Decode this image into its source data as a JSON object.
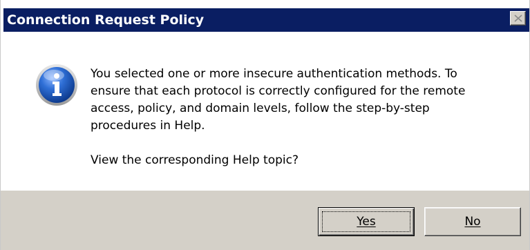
{
  "window": {
    "title": "Connection Request Policy",
    "close_icon": "close-icon"
  },
  "message": {
    "icon": "info-icon",
    "lines": [
      "You selected one or more insecure authentication methods. To",
      "ensure that each protocol is correctly configured for the remote",
      "access, policy, and domain levels, follow the step-by-step",
      "procedures in Help."
    ],
    "question": "View the corresponding Help topic?"
  },
  "buttons": {
    "yes_label": "Yes",
    "no_label": "No"
  },
  "colors": {
    "titlebar": "#0a1e62",
    "footer": "#d4d0c8",
    "icon_blue": "#1c56b8"
  }
}
